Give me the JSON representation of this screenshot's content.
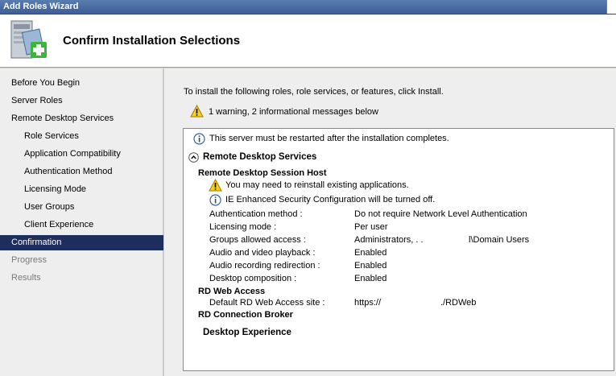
{
  "window": {
    "title": "Add Roles Wizard"
  },
  "header": {
    "page_title": "Confirm Installation Selections",
    "icon": "server-roles-add-icon"
  },
  "nav": {
    "items": [
      {
        "label": "Before You Begin",
        "level": 1,
        "state": "normal"
      },
      {
        "label": "Server Roles",
        "level": 1,
        "state": "normal"
      },
      {
        "label": "Remote Desktop Services",
        "level": 1,
        "state": "normal"
      },
      {
        "label": "Role Services",
        "level": 2,
        "state": "normal"
      },
      {
        "label": "Application Compatibility",
        "level": 2,
        "state": "normal"
      },
      {
        "label": "Authentication Method",
        "level": 2,
        "state": "normal"
      },
      {
        "label": "Licensing Mode",
        "level": 2,
        "state": "normal"
      },
      {
        "label": "User Groups",
        "level": 2,
        "state": "normal"
      },
      {
        "label": "Client Experience",
        "level": 2,
        "state": "normal"
      },
      {
        "label": "Confirmation",
        "level": 1,
        "state": "selected"
      },
      {
        "label": "Progress",
        "level": 1,
        "state": "disabled"
      },
      {
        "label": "Results",
        "level": 1,
        "state": "disabled"
      }
    ]
  },
  "main": {
    "intro": "To install the following roles, role services, or features, click Install.",
    "warning_summary": "1 warning, 2 informational messages below",
    "restart_notice": "This server must be restarted after the installation completes.",
    "rds_section": {
      "title": "Remote Desktop Services",
      "session_host": {
        "title": "Remote Desktop Session Host",
        "warning": "You may need to reinstall existing applications.",
        "info": "IE Enhanced Security Configuration will be turned off.",
        "settings": [
          {
            "key": "Authentication method :",
            "value": "Do not require Network Level Authentication"
          },
          {
            "key": "Licensing mode :",
            "value": "Per user"
          },
          {
            "key": "Groups allowed access :",
            "value": "Administrators, . .",
            "value2": "l\\Domain Users"
          },
          {
            "key": "Audio and video playback :",
            "value": "Enabled"
          },
          {
            "key": "Audio recording redirection :",
            "value": "Enabled"
          },
          {
            "key": "Desktop composition :",
            "value": "Enabled"
          }
        ]
      },
      "web_access": {
        "title": "RD Web Access",
        "key": "Default RD Web Access site :",
        "value": "https://",
        "value2": "./RDWeb"
      },
      "connection_broker": {
        "title": "RD Connection Broker"
      },
      "desktop_experience": {
        "title": "Desktop Experience"
      }
    }
  }
}
